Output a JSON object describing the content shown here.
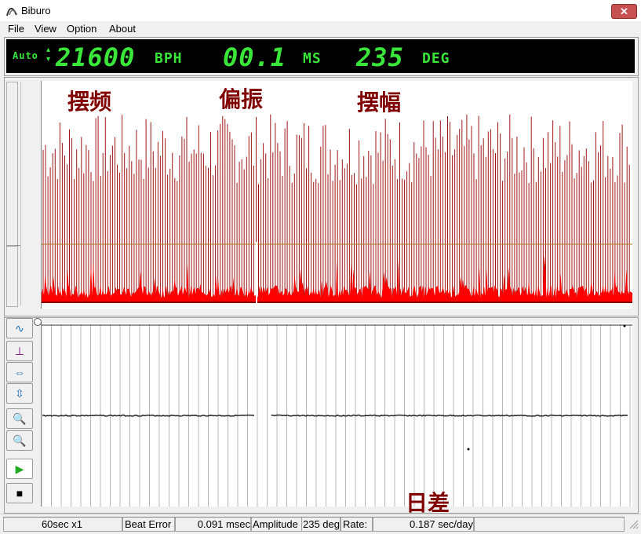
{
  "window": {
    "title": "Biburo",
    "close_glyph": "✕",
    "icon": "app-logo-icon"
  },
  "menu": {
    "file": "File",
    "view": "View",
    "option": "Option",
    "about": "About"
  },
  "lcd": {
    "mode": "Auto",
    "bph_value": "21600",
    "bph_unit": "BPH",
    "ms_value": "00.1",
    "ms_unit": "MS",
    "deg_value": "235",
    "deg_unit": "DEG",
    "color": "#39e639"
  },
  "annotations": {
    "frequency": "摆频",
    "beat_error": "偏振",
    "amplitude": "摆幅",
    "rate": "日差"
  },
  "waveform": {
    "line_color": "#a01818",
    "fill_color": "#ff0000",
    "threshold_color": "#b07a20"
  },
  "toolbar": [
    {
      "name": "waveform-mode-icon",
      "glyph": "∿"
    },
    {
      "name": "trigger-icon",
      "glyph": "⊥"
    },
    {
      "name": "horizontal-zoom-icon",
      "glyph": "⇔"
    },
    {
      "name": "vertical-zoom-icon",
      "glyph": "⇳"
    },
    {
      "name": "zoom-in-icon",
      "glyph": "🔍"
    },
    {
      "name": "zoom-out-icon",
      "glyph": "🔍"
    },
    {
      "name": "play-icon",
      "glyph": "▶"
    },
    {
      "name": "stop-icon",
      "glyph": "■"
    }
  ],
  "status": {
    "period": "60sec x1",
    "beat_error_label": "Beat Error",
    "beat_error_value": "0.091 msec",
    "amplitude_label": "Amplitude",
    "amplitude_value": "235 deg",
    "rate_label": "Rate:",
    "rate_value": "0.187 sec/day"
  }
}
